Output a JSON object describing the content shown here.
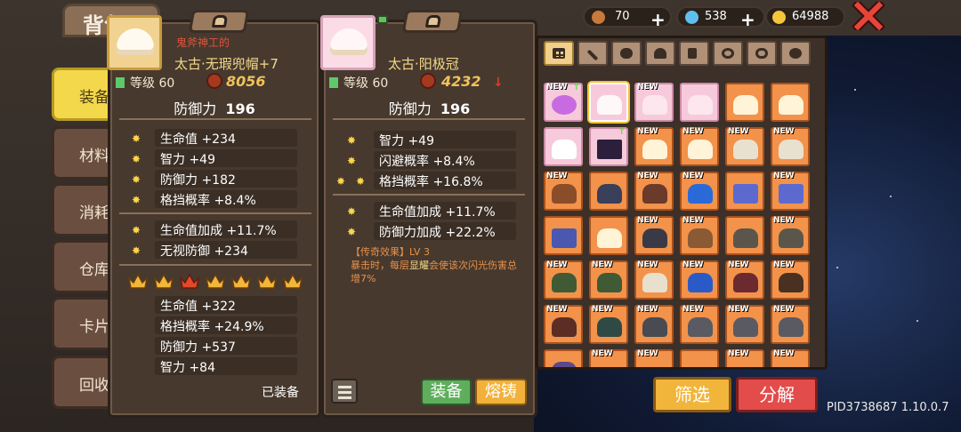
{
  "bag_title": "背包",
  "side_tabs": [
    "装备",
    "材料",
    "消耗",
    "仓库",
    "卡片",
    "回收"
  ],
  "currency": {
    "wood": "70",
    "gems": "538",
    "gold": "64988"
  },
  "equipped_item": {
    "maker": "鬼斧神工的",
    "name": "太古·无瑕兜帽+7",
    "level_label": "等级 60",
    "score": "8056",
    "defense_label": "防御力",
    "defense_value": "196",
    "base_stats": [
      "生命值 +234",
      "智力 +49",
      "防御力 +182",
      "格挡概率 +8.4%"
    ],
    "bonus_stats": [
      "生命值加成 +11.7%",
      "无视防御 +234"
    ],
    "crown_stats": [
      "生命值 +322",
      "格挡概率 +24.9%",
      "防御力 +537",
      "智力 +84"
    ],
    "equipped_label": "已装备"
  },
  "compare_item": {
    "name": "太古·阳极冠",
    "level_label": "等级 60",
    "score": "4232",
    "defense_label": "防御力",
    "defense_value": "196",
    "base_stats": [
      "智力 +49",
      "闪避概率 +8.4%",
      "格挡概率 +16.8%"
    ],
    "bonus_stats": [
      "生命值加成 +11.7%",
      "防御力加成 +22.2%"
    ],
    "legend_title": "【传奇效果】LV 3",
    "legend_text_a": "暴击时，每层",
    "legend_text_hl": "显耀",
    "legend_text_b": "会使该次闪光伤害总增7%",
    "equip_label": "装备",
    "forge_label": "熔铸"
  },
  "inventory": {
    "new_tag": "NEW",
    "filter_button": "筛选",
    "decompose_button": "分解"
  },
  "pid_text": "PID3738687 1.10.0.7",
  "colors": {
    "accent_gold": "#f2b53b",
    "danger_red": "#e24c4b",
    "green": "#5fae5b",
    "orange_slot": "#f3924a",
    "pink_slot": "#f7cadb"
  }
}
